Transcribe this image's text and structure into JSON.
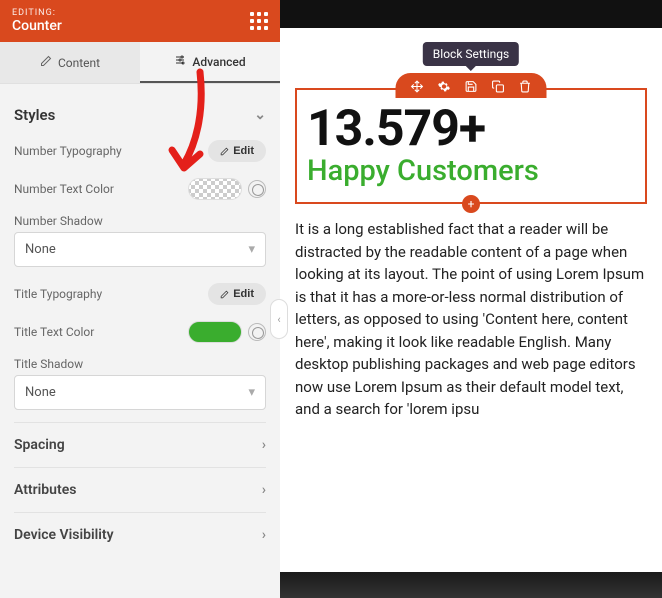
{
  "header": {
    "editing": "EDITING:",
    "title": "Counter"
  },
  "tabs": {
    "content": "Content",
    "advanced": "Advanced"
  },
  "styles": {
    "title": "Styles",
    "number_typography": "Number Typography",
    "number_text_color": "Number Text Color",
    "number_shadow": "Number Shadow",
    "title_typography": "Title Typography",
    "title_text_color": "Title Text Color",
    "title_shadow": "Title Shadow",
    "edit": "Edit",
    "none": "None"
  },
  "sections": {
    "spacing": "Spacing",
    "attributes": "Attributes",
    "device": "Device Visibility"
  },
  "preview": {
    "tooltip": "Block Settings",
    "number": "13.579+",
    "subtitle": "Happy Customers",
    "paragraph": "It is a long established fact that a reader will be distracted by the readable content of a page when looking at its layout. The point of using Lorem Ipsum is that it has a more-or-less normal distribution of letters, as opposed to using 'Content here, content here', making it look like readable English. Many desktop publishing packages and web page editors now use Lorem Ipsum as their default model text, and a search for 'lorem ipsu"
  },
  "colors": {
    "title_text": "#3aad2e",
    "accent": "#d9491e"
  }
}
